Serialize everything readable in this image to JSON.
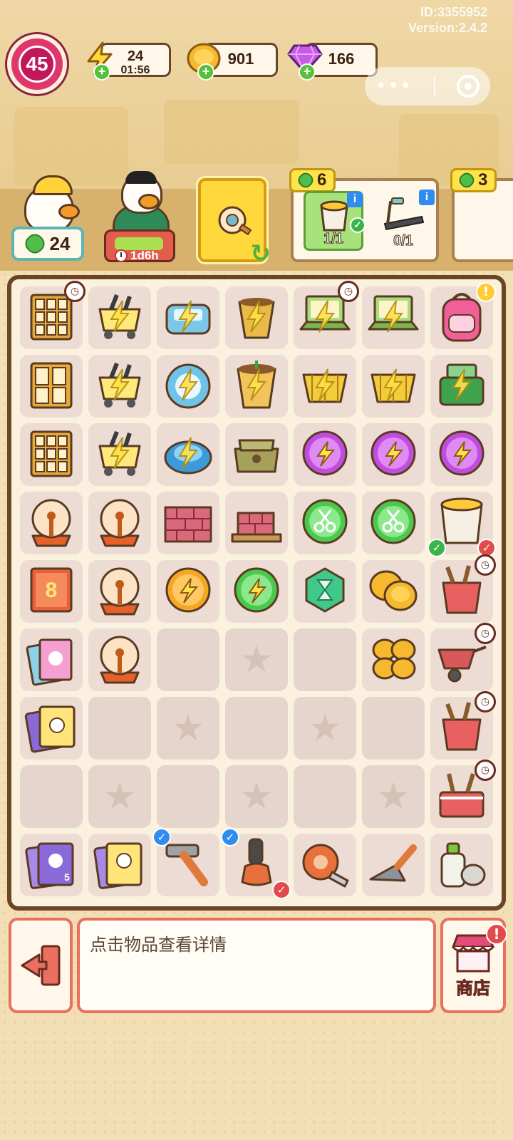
{
  "meta": {
    "id_text": "ID:3355952",
    "version_text": "Version:2.4.2"
  },
  "hud": {
    "level": "45",
    "energy": {
      "value": "24",
      "timer": "01:56"
    },
    "coins": {
      "value": "901"
    },
    "gems": {
      "value": "166"
    }
  },
  "characters": [
    {
      "name": "worker-duck",
      "count": "24"
    },
    {
      "name": "student-duck",
      "timer": "1d6h",
      "progress": 0.85
    }
  ],
  "orders": [
    {
      "reward": "6",
      "requirements": [
        {
          "item": "paint-bucket",
          "progress": "1/1",
          "done": true
        },
        {
          "item": "treadmill",
          "progress": "0/1",
          "done": false
        }
      ]
    },
    {
      "reward": "3",
      "requirements": []
    }
  ],
  "board": {
    "rows": [
      [
        "cabinet",
        "cart-tools",
        "bread-machine",
        "plant-pot-small",
        "laptop",
        "laptop",
        "backpack"
      ],
      [
        "cabinet-open",
        "cart-tools",
        "robot-vacuum",
        "plant-pot",
        "shopping-basket",
        "shopping-basket",
        "cash-register"
      ],
      [
        "cabinet",
        "cart-tools",
        "robot-vacuum-blue",
        "sacks",
        "energy-orb-purple",
        "energy-orb-purple",
        "energy-orb-purple"
      ],
      [
        "plasma-ball",
        "plasma-ball",
        "bricks-stack",
        "bricks-pallet",
        "scissors-orb",
        "scissors-orb",
        "paint-bucket"
      ],
      [
        "book-8",
        "plasma-ball",
        "energy-orb-orange",
        "energy-orb-green",
        "hourglass-hex",
        "coins-2",
        "bucket-tools"
      ],
      [
        "magazines",
        "plasma-ball",
        "empty",
        "star",
        "empty",
        "coins-4",
        "wheelbarrow"
      ],
      [
        "cards-stack",
        "empty",
        "star",
        "empty",
        "star",
        "empty",
        "bucket-tools"
      ],
      [
        "empty",
        "star",
        "empty",
        "star",
        "empty",
        "star",
        "tool-basket"
      ],
      [
        "cards-purple",
        "cards-yellow",
        "hammer",
        "mallet",
        "tape-measure",
        "trowel",
        "spray-can"
      ]
    ]
  },
  "bottom": {
    "hint_text": "点击物品查看详情",
    "shop_label": "商店"
  },
  "colors": {
    "accent_red": "#e8705e",
    "board_border": "#6a4526",
    "level_pink": "#e0366f",
    "energy_yellow": "#ffd93b",
    "plus_green": "#55c23a"
  }
}
